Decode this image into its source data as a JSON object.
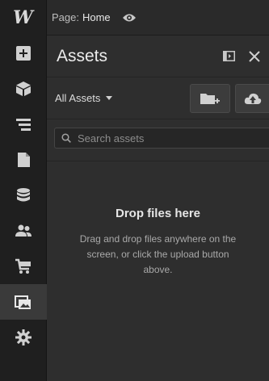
{
  "rail": {
    "logo": "W",
    "items": [
      {
        "name": "add",
        "icon": "plus-square-icon",
        "active": false
      },
      {
        "name": "components",
        "icon": "cube-icon",
        "active": false
      },
      {
        "name": "navigator",
        "icon": "layers-icon",
        "active": false
      },
      {
        "name": "pages",
        "icon": "page-icon",
        "active": false
      },
      {
        "name": "cms",
        "icon": "database-icon",
        "active": false
      },
      {
        "name": "users",
        "icon": "users-icon",
        "active": false
      },
      {
        "name": "ecommerce",
        "icon": "cart-icon",
        "active": false
      },
      {
        "name": "assets",
        "icon": "images-icon",
        "active": true
      },
      {
        "name": "settings",
        "icon": "gear-icon",
        "active": false
      }
    ]
  },
  "topbar": {
    "page_label": "Page:",
    "page_value": "Home"
  },
  "panel": {
    "title": "Assets",
    "filter_label": "All Assets",
    "search_placeholder": "Search assets",
    "drop_title": "Drop files here",
    "drop_body": "Drag and drop files anywhere on the screen, or click the upload button above."
  },
  "colors": {
    "rail_bg": "#1f1f1f",
    "panel_bg": "#2e2e2e",
    "active_bg": "#3a3a3a",
    "icon": "#d0d0d0"
  }
}
